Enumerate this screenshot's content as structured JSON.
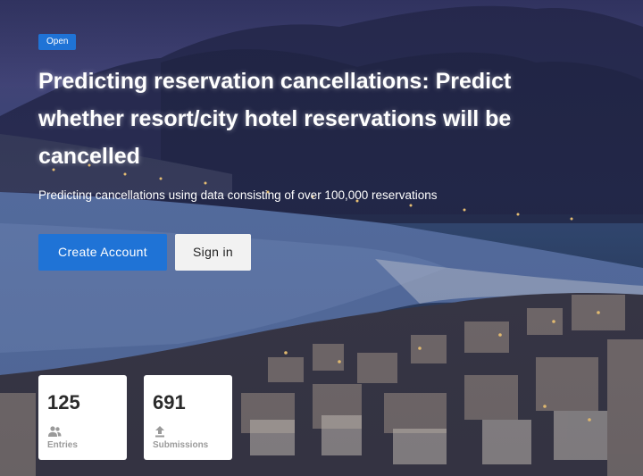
{
  "status_badge": "Open",
  "title": "Predicting reservation cancellations: Predict whether resort/city hotel reservations will be cancelled",
  "subtitle": "Predicting cancellations using data consisting of over 100,000 reservations",
  "buttons": {
    "create_account": "Create Account",
    "sign_in": "Sign in"
  },
  "stats": {
    "entries": {
      "value": "125",
      "label": "Entries",
      "icon": "people-icon"
    },
    "submissions": {
      "value": "691",
      "label": "Submissions",
      "icon": "upload-icon"
    }
  },
  "colors": {
    "accent": "#1f73d6",
    "signin_bg": "#f2f2f2",
    "card_bg": "#ffffff"
  }
}
